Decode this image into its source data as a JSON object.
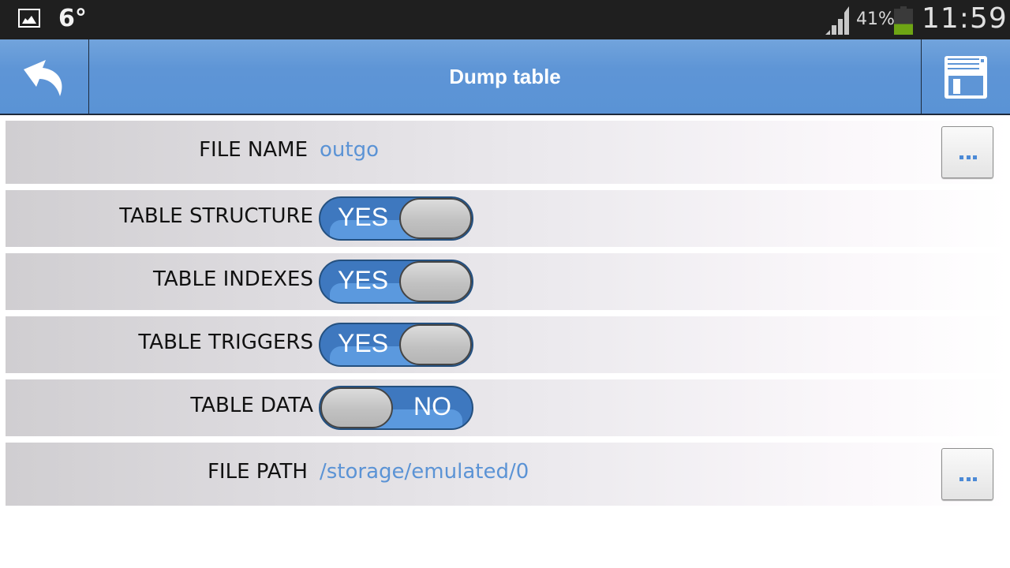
{
  "status_bar": {
    "notification_icon": "image-icon",
    "temperature": "6°",
    "signal_icon": "signal-bars-icon",
    "battery_percent": "41%",
    "battery_icon": "battery-icon",
    "battery_level": 0.41,
    "time": "11:59"
  },
  "app_bar": {
    "title": "Dump table",
    "back_icon": "undo-arrow-icon",
    "save_icon": "floppy-disk-icon"
  },
  "form": {
    "file_name": {
      "label": "FILE NAME",
      "value": "outgo",
      "browse_label": "..."
    },
    "toggles": [
      {
        "label": "TABLE STRUCTURE",
        "state": "YES",
        "on": true
      },
      {
        "label": "TABLE INDEXES",
        "state": "YES",
        "on": true
      },
      {
        "label": "TABLE TRIGGERS",
        "state": "YES",
        "on": true
      },
      {
        "label": "TABLE DATA",
        "state": "NO",
        "on": false
      }
    ],
    "file_path": {
      "label": "FILE PATH",
      "value": "/storage/emulated/0",
      "browse_label": "..."
    }
  },
  "colors": {
    "accent": "#5b93d5",
    "app_bar": "#5e95d6",
    "status_bar": "#1f1f1f",
    "battery_fill": "#6ea514"
  }
}
